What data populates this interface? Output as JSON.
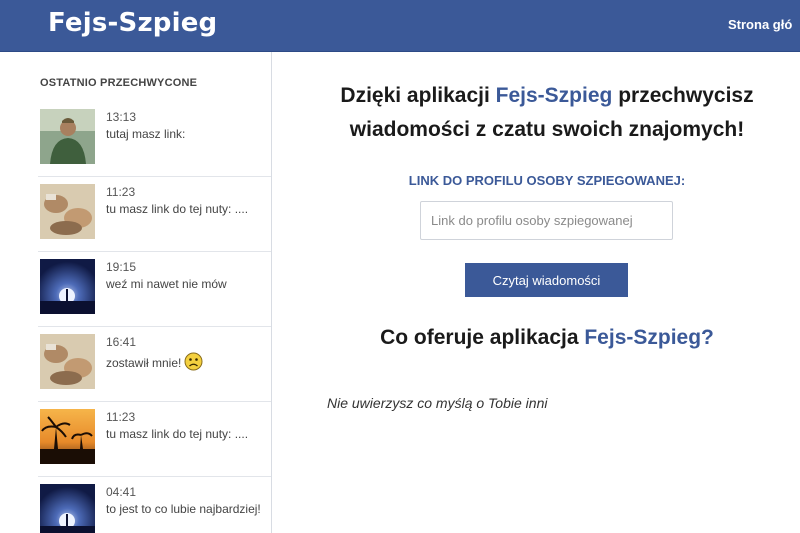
{
  "header": {
    "logo": "Fejs-Szpieg",
    "nav_link": "Strona głó"
  },
  "sidebar": {
    "title": "OSTATNIO PRZECHWYCONE",
    "messages": [
      {
        "time": "13:13",
        "text": "tutaj masz link:"
      },
      {
        "time": "11:23",
        "text": "tu masz link do tej nuty: ...."
      },
      {
        "time": "19:15",
        "text": "weź mi nawet nie mów"
      },
      {
        "time": "16:41",
        "text": "zostawił mnie!",
        "emoji": "sad-face-icon"
      },
      {
        "time": "11:23",
        "text": "tu masz link do tej nuty: ...."
      },
      {
        "time": "04:41",
        "text": "to jest to co lubie najbardziej!"
      }
    ]
  },
  "main": {
    "heading_part1": "Dzięki aplikacji ",
    "heading_brand": "Fejs-Szpieg",
    "heading_part2": " przechwycisz wiadomości z czatu swoich znajomych!",
    "profile_label": "LINK DO PROFILU OSOBY SZPIEGOWANEJ:",
    "profile_placeholder": "Link do profilu osoby szpiegowanej",
    "read_button": "Czytaj wiadomości",
    "offer_part1": "Co oferuje aplikacja ",
    "offer_brand": "Fejs-Szpieg?",
    "tagline": "Nie uwierzysz co myślą o Tobie inni"
  },
  "colors": {
    "brand": "#3b5998",
    "text": "#1a1a1a"
  }
}
